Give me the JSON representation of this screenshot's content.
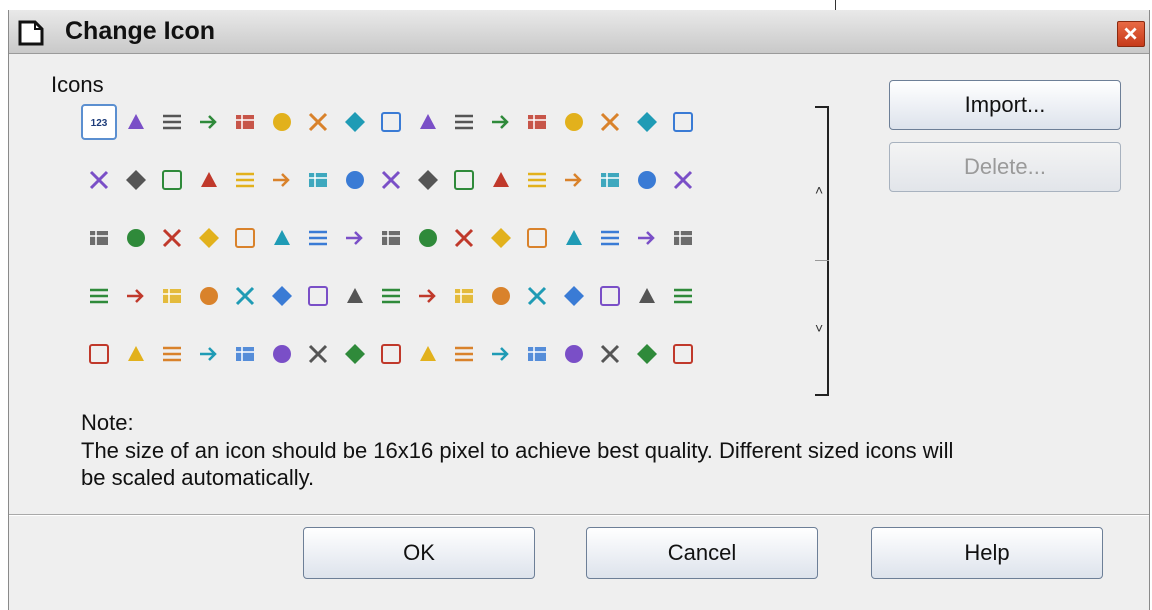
{
  "window": {
    "title": "Change Icon",
    "close_icon": "close-icon"
  },
  "icons_section": {
    "label": "Icons",
    "icons": [
      [
        "numbering-123-icon",
        "bracket-arrow-icon",
        "puzzle-arrow-icon",
        "sphere-arrow-icon",
        "table-grid-icon",
        "frame-dotted-icon",
        "sort-za-icon",
        "align-justify-icon",
        "align-lines-icon",
        "formula-icon",
        "back-arrow-icon",
        "horizontal-line-icon",
        "number-format-icon",
        "merge-icon",
        "delete-cross-icon",
        "currency-percent-icon",
        "table-icon"
      ],
      [
        "form-fields-icon",
        "column-split-icon",
        "picture-icon",
        "colors-icon",
        "database-icon",
        "pointer-icon",
        "circle-blue-icon",
        "table-fields-icon",
        "paragraph-icon",
        "rounded-square-icon",
        "magic-wand-icon",
        "tape-icon",
        "diamond-icon",
        "wedge-icon",
        "pencil-icon",
        "export-icon",
        "floppy-save-icon"
      ],
      [
        "document-icon",
        "grid-dots-icon",
        "hexagon-icon",
        "paint-tool-icon",
        "color-blocks-icon",
        "center-align-icon",
        "ln-field-icon",
        "indent-icon",
        "zoom-page-icon",
        "text-frame-icon",
        "arc-icon",
        "globe-plus-icon",
        "cursor-icon",
        "checkbox-list-icon",
        "back-page-icon",
        "spellcheck-icon",
        "spreadsheet-icon"
      ],
      [
        "paint-bucket-icon",
        "play-sparkle-icon",
        "stepper-icon",
        "play-box-icon",
        "wedge-shape-icon",
        "pentagon-icon",
        "abc-text-icon",
        "document-sun-icon",
        "vertical-arrows-icon",
        "rotate-icon",
        "down-arrow-icon",
        "outline-list-icon",
        "scissors-icon",
        "line-tool-icon",
        "text-box-icon",
        "forward-arrow-icon",
        "field-arrow-icon"
      ],
      [
        "smiley-icon",
        "horizontal-lines-icon",
        "grid-small-icon",
        "circle-outline-icon",
        "freehand-icon",
        "table-pointer-icon",
        "connector-icon",
        "orange-table-icon",
        "skip-forward-icon",
        "shield-icon",
        "calendar-icon",
        "list-box-icon",
        "green-x-icon",
        "funnel-icon",
        "font-size-icon",
        "triangle-icon",
        "hexagon-dark-icon"
      ]
    ]
  },
  "scroll": {
    "up_icon": "chevron-up-icon",
    "down_icon": "chevron-down-icon",
    "up_glyph": "˄",
    "down_glyph": "˅"
  },
  "buttons": {
    "import": "Import...",
    "delete": "Delete...",
    "ok": "OK",
    "cancel": "Cancel",
    "help": "Help"
  },
  "note": {
    "label": "Note:",
    "text": "The size of an icon should be 16x16 pixel to achieve best quality. Different sized icons will be scaled automatically."
  }
}
